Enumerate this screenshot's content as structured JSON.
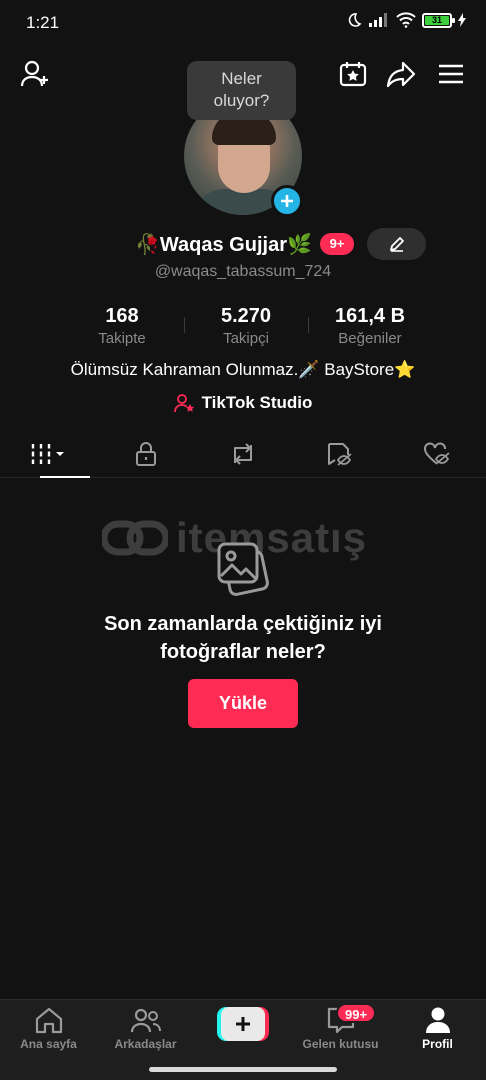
{
  "status_bar": {
    "time": "1:21",
    "battery": "31"
  },
  "tooltip": {
    "line1": "Neler",
    "line2": "oluyor?"
  },
  "profile": {
    "name": "🥀Waqas Gujjar🌿",
    "notification_badge": "9+",
    "handle": "@waqas_tabassum_724",
    "bio": "Ölümsüz Kahraman Olunmaz.🗡️ BayStore⭐",
    "studio_link": "TikTok Studio"
  },
  "stats": [
    {
      "value": "168",
      "label": "Takipte"
    },
    {
      "value": "5.270",
      "label": "Takipçi"
    },
    {
      "value": "161,4 B",
      "label": "Beğeniler"
    }
  ],
  "tabs": [
    "videos-grid",
    "private",
    "reposts",
    "favorites-hidden",
    "liked-hidden"
  ],
  "watermark": {
    "text": "itemsatış"
  },
  "empty_state": {
    "title": "Son zamanlarda çektiğiniz iyi fotoğraflar neler?",
    "button": "Yükle"
  },
  "bottom_nav": {
    "home": "Ana sayfa",
    "friends": "Arkadaşlar",
    "inbox": "Gelen kutusu",
    "inbox_badge": "99+",
    "profile": "Profil"
  },
  "colors": {
    "accent": "#fe2c55",
    "cyan": "#25f4ee",
    "background": "#121212"
  }
}
